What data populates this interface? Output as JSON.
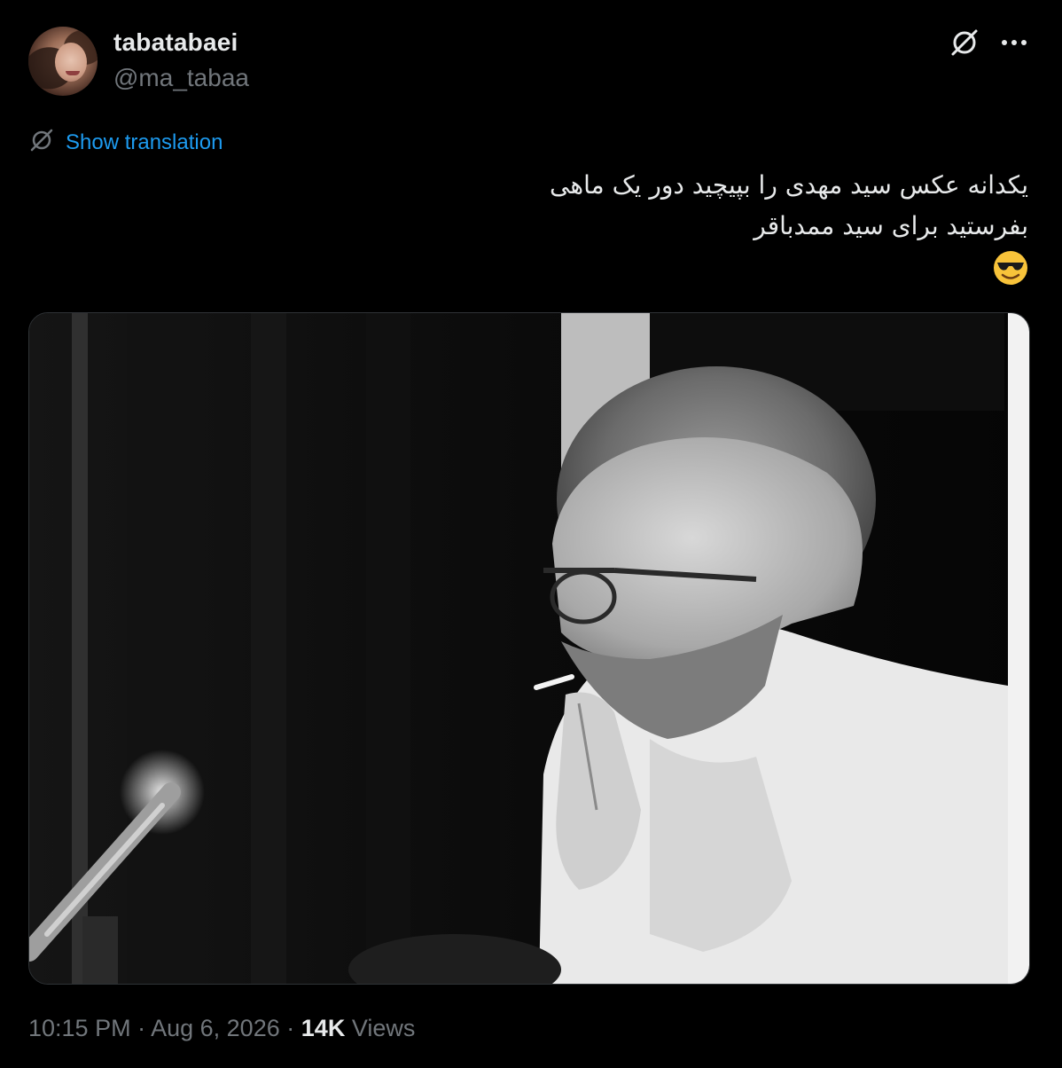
{
  "author": {
    "display_name": "tabatabaei",
    "handle": "@ma_tabaa",
    "avatar_icon": "profile-photo"
  },
  "header_actions": {
    "grok_icon": "slashed-circle-icon",
    "more_icon": "more-horizontal-icon"
  },
  "translation": {
    "icon": "slashed-circle-icon",
    "label": "Show translation"
  },
  "tweet": {
    "lines": [
      "یکدانه عکس سید مهدی را بپیچید دور یک ماهی",
      "بفرستید برای سید ممدباقر"
    ],
    "emoji": "smiling-face-with-sunglasses"
  },
  "media": {
    "type": "photo",
    "tone": "black-and-white"
  },
  "meta": {
    "time": "10:15 PM",
    "separator": "·",
    "date": "Aug 6, 2026",
    "views_count": "14K",
    "views_label": "Views"
  },
  "colors": {
    "background": "#000000",
    "primary_text": "#e7e9ea",
    "secondary_text": "#71767b",
    "link": "#1d9bf0",
    "emoji_yellow": "#f8c33a"
  }
}
